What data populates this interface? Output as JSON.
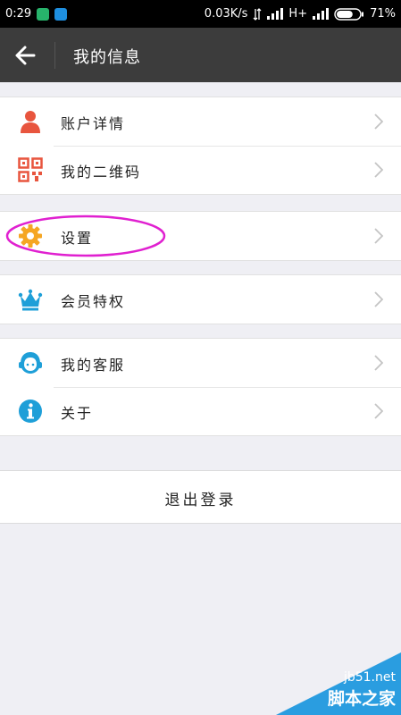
{
  "status_bar": {
    "time": "0:29",
    "network_speed": "0.03K/s",
    "network_type": "H+",
    "battery_percent": "71%",
    "battery_level": 0.71
  },
  "header": {
    "title": "我的信息",
    "back_icon": "arrow-left-icon"
  },
  "menu_groups": [
    {
      "items": [
        {
          "label": "账户详情",
          "icon": "user-icon",
          "color": "#e8553e"
        },
        {
          "label": "我的二维码",
          "icon": "qr-code-icon",
          "color": "#e8553e"
        }
      ]
    },
    {
      "items": [
        {
          "label": "设置",
          "icon": "gear-icon",
          "color": "#f5a623"
        }
      ]
    },
    {
      "items": [
        {
          "label": "会员特权",
          "icon": "crown-icon",
          "color": "#1e9fd8"
        }
      ]
    },
    {
      "items": [
        {
          "label": "我的客服",
          "icon": "customer-service-icon",
          "color": "#1e9fd8"
        },
        {
          "label": "关于",
          "icon": "info-icon",
          "color": "#1e9fd8"
        }
      ]
    }
  ],
  "logout": {
    "label": "退出登录"
  },
  "annotation": {
    "color": "#e020d0"
  },
  "watermark": {
    "url": "jb51.net",
    "text": "脚本之家",
    "color": "#2a9de0"
  }
}
